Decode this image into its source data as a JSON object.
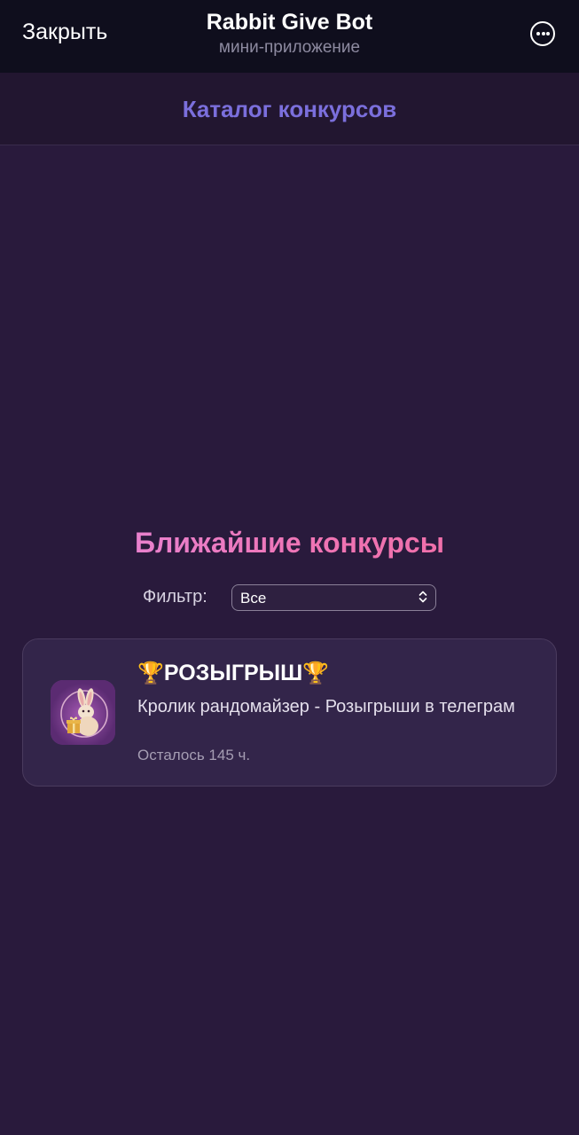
{
  "telegram_bar": {
    "close_label": "Закрыть",
    "title": "Rabbit Give Bot",
    "subtitle": "мини-приложение"
  },
  "header": {
    "title": "Каталог конкурсов"
  },
  "section": {
    "title": "Ближайшие конкурсы",
    "filter_label": "Фильтр:",
    "filter_selected": "Все"
  },
  "contests": [
    {
      "trophy_left": "🏆",
      "title": "РОЗЫГРЫШ",
      "trophy_right": "🏆",
      "description": "Кролик рандомайзер - Розыгрыши в телеграм",
      "time_left": "Осталось 145 ч.",
      "avatar_icon": "rabbit-with-gift-icon"
    }
  ],
  "colors": {
    "background": "#291a3c",
    "header_title": "#7b6fdc",
    "section_gradient_start": "#e48ae0",
    "section_gradient_end": "#f06ba0",
    "card_background": "#33254a"
  }
}
